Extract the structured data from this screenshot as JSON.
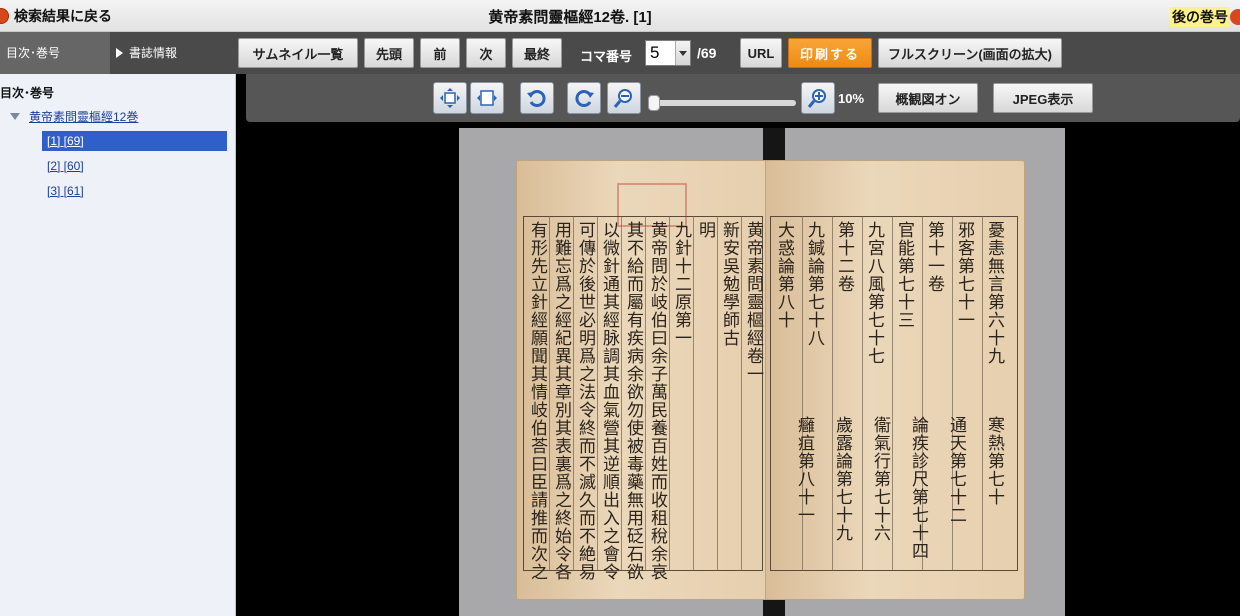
{
  "header": {
    "back_label": "検索結果に戻る",
    "title": "黄帝素問靈樞經12卷. [1]",
    "next_volume_label": "後の巻号"
  },
  "toolbar": {
    "tab_toc": "目次･巻号",
    "tab_biblio": "書誌情報",
    "thumbnail_list": "サムネイル一覧",
    "first": "先頭",
    "prev": "前",
    "next": "次",
    "last": "最終",
    "frame_label": "コマ番号",
    "frame_value": "5",
    "frame_total": "/69",
    "url": "URL",
    "print": "印刷する",
    "fullscreen": "フルスクリーン(画面の拡大)"
  },
  "sidebar": {
    "heading": "目次･巻号",
    "volume": "黄帝素問靈樞經12巻",
    "frames": [
      "[1] [69]",
      "[2] [60]",
      "[3] [61]"
    ],
    "active_index": 0
  },
  "viewer": {
    "zoom": "10%",
    "overview_toggle": "概観図オン",
    "jpeg": "JPEG表示",
    "zoom_level": 0.0
  },
  "scan": {
    "left_columns": [
      "有形先立針經願聞其情岐伯荅曰臣請推而次之",
      "用難忘爲之經紀異其章別其表裏爲之終始令各",
      "可傳於後世必明爲之法令終而不滅久而不絶易",
      "以微針通其經脉調其血氣營其逆順出入之會令",
      "其不給而屬有疾病余欲勿使被毒藥無用砭石欲",
      "黄帝問於岐伯曰余子萬民養百姓而收租稅余哀",
      "九針十二原第一",
      "明",
      "新安吳勉學師古",
      "黄帝素問靈樞經卷一"
    ],
    "right_columns": [
      "大惑論第八十",
      "九鍼論第七十八",
      "第十二卷",
      "九宮八風第七十七",
      "官能第七十三",
      "第十一卷",
      "邪客第七十一",
      "憂恚無言第六十九"
    ],
    "right_lower": [
      "癰疽第八十一",
      "歲露論第七十九",
      "衞氣行第七十六",
      "論疾診尺第七十四",
      "通天第七十二",
      "寒熱第七十"
    ]
  }
}
